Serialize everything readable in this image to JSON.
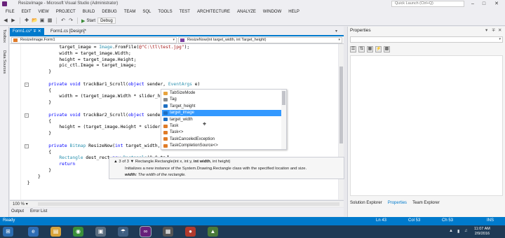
{
  "window": {
    "title": "ResizeImage - Microsoft Visual Studio (Administrator)",
    "quick_launch_placeholder": "Quick Launch (Ctrl+Q)",
    "controls": [
      "–",
      "□",
      "✕"
    ]
  },
  "menu": [
    "FILE",
    "EDIT",
    "VIEW",
    "PROJECT",
    "BUILD",
    "DEBUG",
    "TEAM",
    "SQL",
    "TOOLS",
    "TEST",
    "ARCHITECTURE",
    "ANALYZE",
    "WINDOW",
    "HELP"
  ],
  "toolbar": {
    "start_label": "Start",
    "config_label": "Debug"
  },
  "left_strip": [
    "Toolbox",
    "Data Sources"
  ],
  "doc_tabs": [
    {
      "label": "Form1.cs*",
      "active": true
    },
    {
      "label": "Form1.cs [Design]*",
      "active": false
    }
  ],
  "nav": {
    "class_combo": "ResizeImage.Form1",
    "member_combo": "ResizeNow(int target_width, int Target_height)"
  },
  "code_lines": [
    {
      "indent": 3,
      "parts": [
        {
          "t": "target_image = "
        },
        {
          "t": "Image",
          "c": "ty"
        },
        {
          "t": ".FromFile("
        },
        {
          "t": "@\"C:\\tl\\test.jpg\"",
          "c": "st"
        },
        {
          "t": ");"
        }
      ]
    },
    {
      "indent": 3,
      "parts": [
        {
          "t": "width = target_image.Width;"
        }
      ]
    },
    {
      "indent": 3,
      "parts": [
        {
          "t": "height = target_image.Height;"
        }
      ]
    },
    {
      "indent": 3,
      "parts": [
        {
          "t": "pic_ctl.Image = target_image;"
        }
      ]
    },
    {
      "indent": 2,
      "parts": [
        {
          "t": "}"
        }
      ]
    },
    {
      "indent": 0,
      "parts": []
    },
    {
      "indent": 2,
      "parts": [
        {
          "t": "private",
          "c": "kw"
        },
        {
          "t": " "
        },
        {
          "t": "void",
          "c": "kw"
        },
        {
          "t": " trackBar1_Scroll("
        },
        {
          "t": "object",
          "c": "kw"
        },
        {
          "t": " sender, "
        },
        {
          "t": "EventArgs",
          "c": "ty"
        },
        {
          "t": " e)"
        }
      ]
    },
    {
      "indent": 2,
      "parts": [
        {
          "t": "{"
        }
      ]
    },
    {
      "indent": 3,
      "parts": [
        {
          "t": "width = (target_image.Width * slider_h"
        }
      ]
    },
    {
      "indent": 2,
      "parts": [
        {
          "t": "}"
        }
      ]
    },
    {
      "indent": 0,
      "parts": []
    },
    {
      "indent": 2,
      "parts": [
        {
          "t": "private",
          "c": "kw"
        },
        {
          "t": " "
        },
        {
          "t": "void",
          "c": "kw"
        },
        {
          "t": " trackBar2_Scroll("
        },
        {
          "t": "object",
          "c": "kw"
        },
        {
          "t": " sende"
        }
      ]
    },
    {
      "indent": 2,
      "parts": [
        {
          "t": "{"
        }
      ]
    },
    {
      "indent": 3,
      "parts": [
        {
          "t": "height = (target_image.Height * slider"
        }
      ]
    },
    {
      "indent": 2,
      "parts": [
        {
          "t": "}"
        }
      ]
    },
    {
      "indent": 0,
      "parts": []
    },
    {
      "indent": 2,
      "parts": [
        {
          "t": "private",
          "c": "kw"
        },
        {
          "t": " "
        },
        {
          "t": "Bitmap",
          "c": "ty"
        },
        {
          "t": " ResizeNow("
        },
        {
          "t": "int",
          "c": "kw"
        },
        {
          "t": " target_width,"
        }
      ]
    },
    {
      "indent": 2,
      "parts": [
        {
          "t": "{"
        }
      ]
    },
    {
      "indent": 3,
      "parts": [
        {
          "t": "Rectangle",
          "c": "ty"
        },
        {
          "t": " dest_rect="
        },
        {
          "t": "new",
          "c": "kw"
        },
        {
          "t": " "
        },
        {
          "t": "Rectangle",
          "c": "ty"
        },
        {
          "t": "(0,0,ta"
        }
      ]
    },
    {
      "indent": 3,
      "parts": [
        {
          "t": "return",
          "c": "kw"
        }
      ]
    },
    {
      "indent": 2,
      "parts": [
        {
          "t": "}"
        }
      ]
    },
    {
      "indent": 1,
      "parts": [
        {
          "t": "}"
        }
      ]
    },
    {
      "indent": 0,
      "parts": [
        {
          "t": "}"
        }
      ]
    }
  ],
  "intellisense": [
    {
      "label": "TabSizeMode",
      "icon": "enum-icon",
      "color": "#e8a33d"
    },
    {
      "label": "Tag",
      "icon": "property-icon",
      "color": "#8a8a8a"
    },
    {
      "label": "Target_height",
      "icon": "field-icon",
      "color": "#1e6fc2"
    },
    {
      "label": "target_image",
      "icon": "field-icon",
      "color": "#1e6fc2",
      "selected": true
    },
    {
      "label": "target_width",
      "icon": "field-icon",
      "color": "#1e6fc2"
    },
    {
      "label": "Task",
      "icon": "class-icon",
      "color": "#e07b27"
    },
    {
      "label": "Task<>",
      "icon": "class-icon",
      "color": "#e07b27"
    },
    {
      "label": "TaskCanceledException",
      "icon": "class-icon",
      "color": "#e07b27"
    },
    {
      "label": "TaskCompletionSource<>",
      "icon": "class-icon",
      "color": "#e07b27"
    }
  ],
  "signature_tip": {
    "counter": "3 of 3",
    "sig_prefix": "Rectangle.Rectangle(int x, int y, ",
    "sig_bold": "int width",
    "sig_suffix": ", int height)",
    "description": "Initializes a new instance of the System.Drawing.Rectangle class with the specified location and size.",
    "param_name": "width:",
    "param_desc": "The width of the rectangle."
  },
  "zoom": "100 %",
  "bottom_tabs": [
    "Output",
    "Error List"
  ],
  "properties": {
    "title": "Properties",
    "tabs": [
      "Solution Explorer",
      "Properties",
      "Team Explorer"
    ]
  },
  "status": {
    "ready": "Ready",
    "ln": "Ln 43",
    "col": "Col 53",
    "ch": "Ch 53",
    "mode": "INS"
  },
  "taskbar": {
    "time": "11:07 AM",
    "date": "2/9/2016"
  },
  "colors": {
    "accent": "#007acc",
    "selection": "#3399ff",
    "taskbar": "#1f3a55"
  }
}
